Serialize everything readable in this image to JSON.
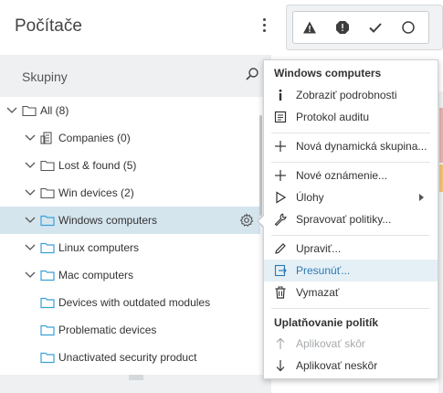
{
  "panel": {
    "title": "Počítače",
    "groups_label": "Skupiny"
  },
  "tree": [
    {
      "label": "All (8)",
      "icon": "folder-icon",
      "selected": false
    },
    {
      "label": "Companies (0)",
      "icon": "companies-icon",
      "selected": false
    },
    {
      "label": "Lost & found (5)",
      "icon": "folder-icon",
      "selected": false
    },
    {
      "label": "Win devices (2)",
      "icon": "folder-icon",
      "selected": false
    },
    {
      "label": "Windows computers",
      "icon": "folder-icon",
      "selected": true
    },
    {
      "label": "Linux computers",
      "icon": "folder-icon",
      "selected": false
    },
    {
      "label": "Mac computers",
      "icon": "folder-icon",
      "selected": false
    },
    {
      "label": "Devices with outdated modules",
      "icon": "dynamic-folder-icon",
      "selected": false
    },
    {
      "label": "Problematic devices",
      "icon": "dynamic-folder-icon",
      "selected": false
    },
    {
      "label": "Unactivated security product",
      "icon": "dynamic-folder-icon",
      "selected": false
    }
  ],
  "menu": {
    "section1_title": "Windows computers",
    "items": [
      {
        "label": "Zobraziť podrobnosti",
        "icon": "info-icon"
      },
      {
        "label": "Protokol auditu",
        "icon": "audit-log-icon"
      },
      {
        "label": "Nová dynamická skupina...",
        "icon": "plus-icon"
      },
      {
        "label": "Nové oznámenie...",
        "icon": "plus-icon"
      },
      {
        "label": "Úlohy",
        "icon": "play-icon"
      },
      {
        "label": "Spravovať politiky...",
        "icon": "wrench-icon"
      },
      {
        "label": "Upraviť...",
        "icon": "pencil-icon"
      },
      {
        "label": "Presunúť...",
        "icon": "move-icon"
      },
      {
        "label": "Vymazať",
        "icon": "trash-icon"
      }
    ],
    "section2_title": "Uplatňovanie politík",
    "policy_items": [
      {
        "label": "Aplikovať skôr",
        "icon": "arrow-up-icon"
      },
      {
        "label": "Aplikovať neskôr",
        "icon": "arrow-down-icon"
      }
    ]
  },
  "colors": {
    "selected_row": "#d5e5ee",
    "menu_highlight": "#e5f0f6",
    "accent": "#2b79b4",
    "folder_blue": "#3aa0d8"
  }
}
